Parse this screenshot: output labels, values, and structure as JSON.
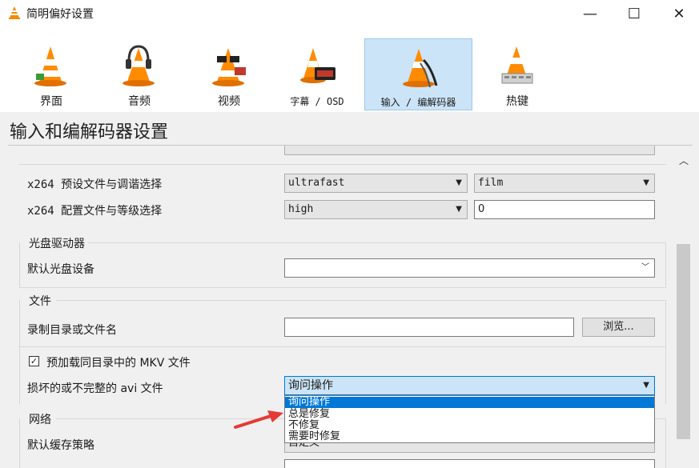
{
  "window": {
    "title": "简明偏好设置",
    "min_glyph": "—",
    "max_glyph": "☐",
    "close_glyph": "✕"
  },
  "toolbar": {
    "items": [
      {
        "label": "界面",
        "icon": "vlc-cone-interface-icon"
      },
      {
        "label": "音频",
        "icon": "vlc-cone-headphones-icon"
      },
      {
        "label": "视频",
        "icon": "vlc-cone-glasses-icon"
      },
      {
        "label": "字幕 / OSD",
        "icon": "vlc-cone-clock-icon"
      },
      {
        "label": "输入 / 编解码器",
        "icon": "vlc-cone-cables-icon",
        "selected": true
      },
      {
        "label": "热键",
        "icon": "vlc-cone-keyboard-icon"
      }
    ]
  },
  "section_heading": "输入和编解码器设置",
  "x264": {
    "preset_label": "x264 预设文件与调谐选择",
    "preset_value": "ultrafast",
    "tune_value": "film",
    "profile_label": "x264 配置文件与等级选择",
    "profile_value": "high",
    "level_value": "0"
  },
  "optical": {
    "group_title": "光盘驱动器",
    "device_label": "默认光盘设备",
    "device_value": ""
  },
  "files": {
    "group_title": "文件",
    "record_label": "录制目录或文件名",
    "record_value": "",
    "browse_label": "浏览...",
    "preload_mkv_label": "预加载同目录中的 MKV 文件",
    "preload_mkv_checked": true,
    "damaged_avi_label": "损坏的或不完整的 avi 文件",
    "damaged_avi_value": "询问操作",
    "damaged_avi_options": [
      "询问操作",
      "总是修复",
      "不修复",
      "需要时修复"
    ]
  },
  "network": {
    "group_title": "网络",
    "cache_label": "默认缓存策略",
    "cache_value": "自定义"
  },
  "colors": {
    "selection": "#0078d7",
    "selected_tab": "#cce4f7",
    "annotation_arrow": "#e53935"
  }
}
